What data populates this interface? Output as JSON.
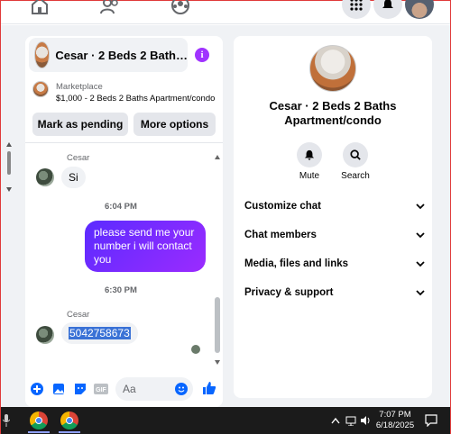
{
  "nav": {
    "icons": [
      "home-icon",
      "friends-icon",
      "groups-icon",
      "menu-grid-icon",
      "notifications-icon",
      "profile-avatar"
    ]
  },
  "chat": {
    "title": "Cesar · 2 Beds 2 Bath…",
    "listing": {
      "source": "Marketplace",
      "summary": "$1,000 - 2 Beds 2 Baths Apartment/condo"
    },
    "buttons": {
      "mark_pending": "Mark as pending",
      "more_options": "More options"
    },
    "messages": [
      {
        "sender": "Cesar",
        "text": "Si"
      },
      {
        "timestamp": "6:04 PM"
      },
      {
        "outgoing": "please  send me your number i will contact you"
      },
      {
        "timestamp": "6:30 PM"
      },
      {
        "sender": "Cesar",
        "text": "5042758673"
      }
    ],
    "composer": {
      "placeholder": "Aa"
    }
  },
  "info_panel": {
    "title": "Cesar · 2 Beds 2 Baths Apartment/condo",
    "actions": [
      {
        "label": "Mute",
        "icon": "bell-icon"
      },
      {
        "label": "Search",
        "icon": "search-icon"
      }
    ],
    "sections": [
      "Customize chat",
      "Chat members",
      "Media, files and links",
      "Privacy & support"
    ]
  },
  "taskbar": {
    "time": "7:07 PM",
    "date": "6/18/2025"
  },
  "colors": {
    "accent_purple": "#a033ff",
    "bubble_gradient_start": "#5b2bff",
    "bubble_gradient_end": "#9b2bff",
    "messenger_blue": "#0866ff"
  }
}
